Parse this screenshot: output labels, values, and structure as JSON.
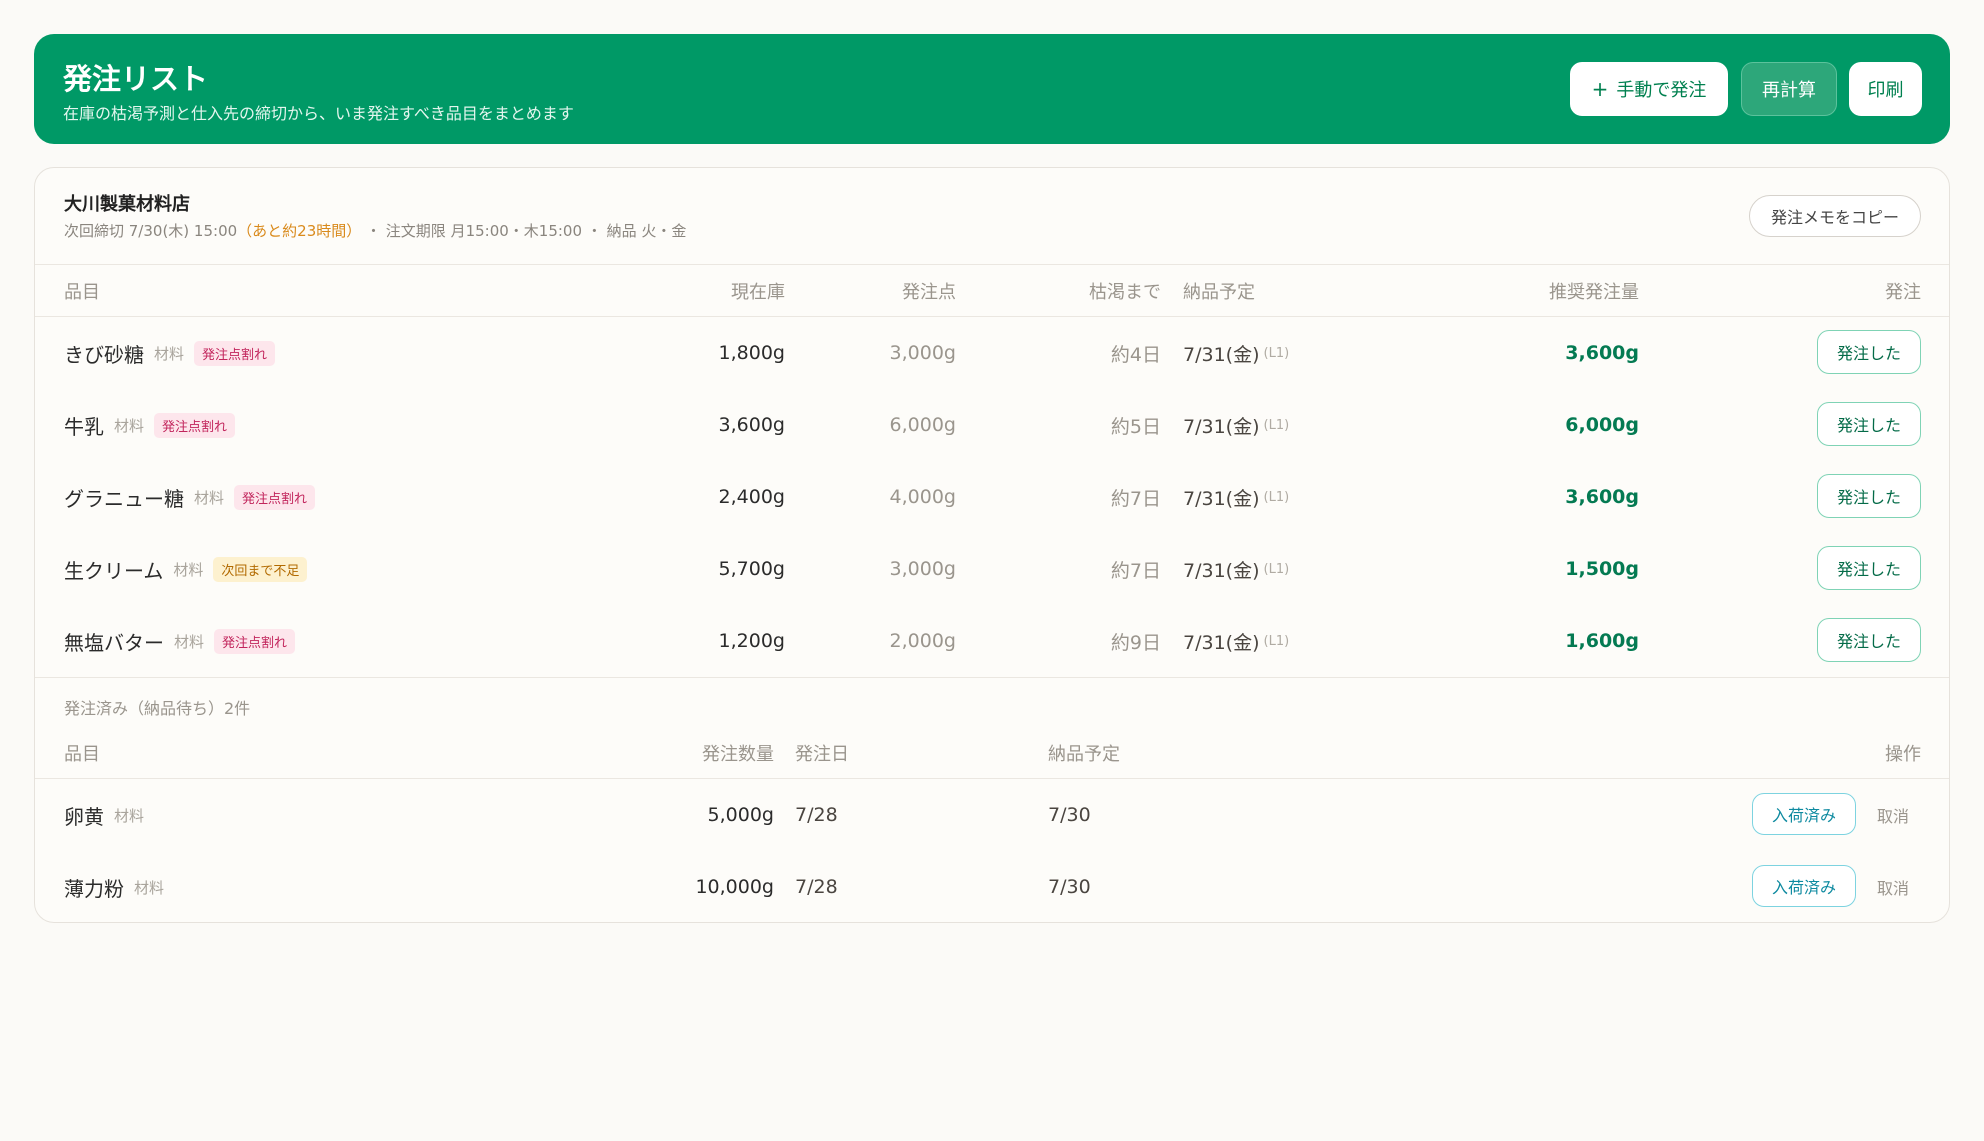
{
  "header": {
    "title": "発注リスト",
    "subtitle": "在庫の枯渇予測と仕入先の締切から、いま発注すべき品目をまとめます",
    "manual_order_label": "手動で発注",
    "recalc_label": "再計算",
    "print_label": "印刷"
  },
  "supplier": {
    "name": "大川製菓材料店",
    "next_deadline": "次回締切 7/30(木) 15:00",
    "time_left": "（あと約23時間）",
    "order_window": "・ 注文期限 月15:00・木15:00",
    "delivery_days": "・ 納品 火・金",
    "copy_memo_label": "発注メモをコピー"
  },
  "order_table": {
    "columns": {
      "item": "品目",
      "stock": "現在庫",
      "reorder_point": "発注点",
      "until_empty": "枯渇まで",
      "delivery": "納品予定",
      "recommended": "推奨発注量",
      "action": "発注"
    },
    "rows": [
      {
        "name": "きび砂糖",
        "category": "材料",
        "badge": "発注点割れ",
        "stock": "1,800g",
        "reorder": "3,000g",
        "days": "約4日",
        "delivery": "7/31(金)",
        "lead": "(L1)",
        "recommended": "3,600g",
        "button": "発注した"
      },
      {
        "name": "牛乳",
        "category": "材料",
        "badge": "発注点割れ",
        "stock": "3,600g",
        "reorder": "6,000g",
        "days": "約5日",
        "delivery": "7/31(金)",
        "lead": "(L1)",
        "recommended": "6,000g",
        "button": "発注した"
      },
      {
        "name": "グラニュー糖",
        "category": "材料",
        "badge": "発注点割れ",
        "stock": "2,400g",
        "reorder": "4,000g",
        "days": "約7日",
        "delivery": "7/31(金)",
        "lead": "(L1)",
        "recommended": "3,600g",
        "button": "発注した"
      },
      {
        "name": "生クリーム",
        "category": "材料",
        "badge": "次回まで不足",
        "stock": "5,700g",
        "reorder": "3,000g",
        "days": "約7日",
        "delivery": "7/31(金)",
        "lead": "(L1)",
        "recommended": "1,500g",
        "button": "発注した"
      },
      {
        "name": "無塩バター",
        "category": "材料",
        "badge": "発注点割れ",
        "stock": "1,200g",
        "reorder": "2,000g",
        "days": "約9日",
        "delivery": "7/31(金)",
        "lead": "(L1)",
        "recommended": "1,600g",
        "button": "発注した"
      }
    ]
  },
  "ordered_section": {
    "label": "発注済み（納品待ち）2件",
    "columns": {
      "item": "品目",
      "quantity": "発注数量",
      "order_date": "発注日",
      "delivery": "納品予定",
      "action": "操作"
    },
    "rows": [
      {
        "name": "卵黄",
        "category": "材料",
        "quantity": "5,000g",
        "order_date": "7/28",
        "delivery": "7/30",
        "arrived_label": "入荷済み",
        "cancel_label": "取消"
      },
      {
        "name": "薄力粉",
        "category": "材料",
        "quantity": "10,000g",
        "order_date": "7/28",
        "delivery": "7/30",
        "arrived_label": "入荷済み",
        "cancel_label": "取消"
      }
    ]
  },
  "colors": {
    "header_green": "#009966",
    "recommended_green": "#047a52",
    "badge_pink": "#c2255c",
    "badge_yellow": "#b26a00",
    "deadline_orange": "#d98a1c"
  }
}
